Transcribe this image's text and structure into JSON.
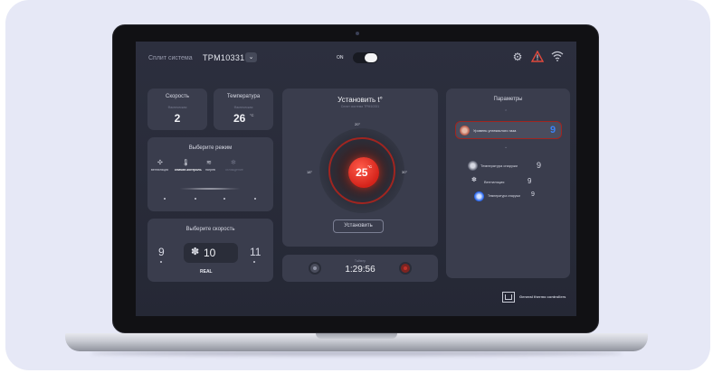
{
  "header": {
    "title": "Сплит система",
    "model": "TPM10331",
    "dropdown_icon": "chevron-down-icon",
    "power_label": "ON",
    "power_on": true,
    "icons": [
      "gear-icon",
      "warning-icon",
      "wifi-icon"
    ],
    "warning_color": "#e0483c"
  },
  "speed_card": {
    "title": "Скорость",
    "sub": "Фактическая",
    "value": "2"
  },
  "temp_card": {
    "title": "Температура",
    "sub": "Фактическая",
    "value": "26",
    "unit": "°C"
  },
  "mode_panel": {
    "title": "Выберите режим",
    "modes": [
      {
        "label": "вентиляция",
        "icon": "fan-icon"
      },
      {
        "label": "климат-контроль",
        "icon": "thermometer-icon",
        "active": true
      },
      {
        "label": "нагрев",
        "icon": "heat-icon"
      },
      {
        "label": "охлаждение",
        "icon": "snowflake-icon"
      }
    ]
  },
  "speed_panel": {
    "title": "Выберите скорость",
    "prev": "9",
    "current": "10",
    "next": "11",
    "caption": "REAL",
    "icon": "fan-icon"
  },
  "setpoint": {
    "title": "Установить t°",
    "subtitle": "Сплит система TPM10331",
    "top_label": "20°",
    "left_label": "18°",
    "right_label": "30°",
    "value": "25",
    "unit": "°C",
    "button": "Установить",
    "accent": "#e0483c"
  },
  "timer": {
    "label": "Таймер",
    "value": "1:29:56",
    "stop_color": "#c0302a"
  },
  "params": {
    "title": "Параметры",
    "items": [
      {
        "label": "Уровень углекислого газа",
        "value": "9",
        "value_color": "#3b82f6",
        "highlight": true
      },
      {
        "label": "Температура снаружи",
        "value": "9"
      },
      {
        "label": "Вентиляция",
        "value": "9"
      },
      {
        "label": "Температура снаружи",
        "value": "9"
      }
    ]
  },
  "footer": {
    "brand": "General thermo controllers"
  }
}
